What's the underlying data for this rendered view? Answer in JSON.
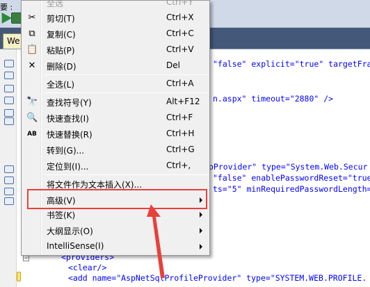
{
  "toolbar": {
    "label": "要 :"
  },
  "document_tab": {
    "label": "We"
  },
  "code_lines": [
    {
      "text": "\"false\" explicit=\"true\" targetFra"
    },
    {
      "text": "n.aspx\" timeout=\"2880\" />"
    },
    {
      "text": "pProvider\" type=\"System.Web.Secur"
    },
    {
      "text": "\"false\" enablePasswordReset=\"true"
    },
    {
      "text": "ts=\"5\" minRequiredPasswordLength="
    },
    {
      "text": "<providers>"
    },
    {
      "text": "<clear/>"
    },
    {
      "text": "<add name=\"AspNetSqlProfileProvider\" type=\"SYSTEM.WEB.PROFILE."
    }
  ],
  "menu": {
    "partial_top": {
      "label": "全选",
      "shortcut": "Ctrl+Y"
    },
    "items": [
      {
        "label": "剪切(T)",
        "shortcut": "Ctrl+X",
        "icon": "scissors-icon",
        "glyph": "✂"
      },
      {
        "label": "复制(C)",
        "shortcut": "Ctrl+C",
        "icon": "copy-icon",
        "glyph": "⧉"
      },
      {
        "label": "粘贴(P)",
        "shortcut": "Ctrl+V",
        "icon": "paste-icon",
        "glyph": "📋"
      },
      {
        "label": "删除(D)",
        "shortcut": "Del",
        "icon": "delete-icon",
        "glyph": "✕"
      },
      {
        "label": "全选(L)",
        "shortcut": "Ctrl+A",
        "icon": "",
        "glyph": ""
      },
      {
        "label": "查找符号(Y)",
        "shortcut": "Alt+F12",
        "icon": "find-symbol-icon",
        "glyph": "🔭"
      },
      {
        "label": "快速查找(I)",
        "shortcut": "Ctrl+F",
        "icon": "quick-find-icon",
        "glyph": "🔍"
      },
      {
        "label": "快速替换(R)",
        "shortcut": "Ctrl+H",
        "icon": "quick-replace-icon",
        "glyph": "AB"
      },
      {
        "label": "转到(G)...",
        "shortcut": "Ctrl+G",
        "icon": "",
        "glyph": ""
      },
      {
        "label": "定位到(I)...",
        "shortcut": "Ctrl+,",
        "icon": "",
        "glyph": ""
      },
      {
        "label": "将文件作为文本插入(X)...",
        "shortcut": "",
        "icon": "",
        "glyph": ""
      },
      {
        "label": "高级(V)",
        "shortcut": "",
        "icon": "",
        "glyph": "",
        "submenu": true
      },
      {
        "label": "书签(K)",
        "shortcut": "",
        "icon": "",
        "glyph": "",
        "submenu": true
      },
      {
        "label": "大纲显示(O)",
        "shortcut": "",
        "icon": "",
        "glyph": "",
        "submenu": true
      },
      {
        "label": "IntelliSense(I)",
        "shortcut": "",
        "icon": "",
        "glyph": "",
        "submenu": true
      }
    ]
  },
  "colors": {
    "annotation": "#e8403a",
    "menu_bg": "#f0f0f0",
    "ide_bg": "#44587a"
  }
}
